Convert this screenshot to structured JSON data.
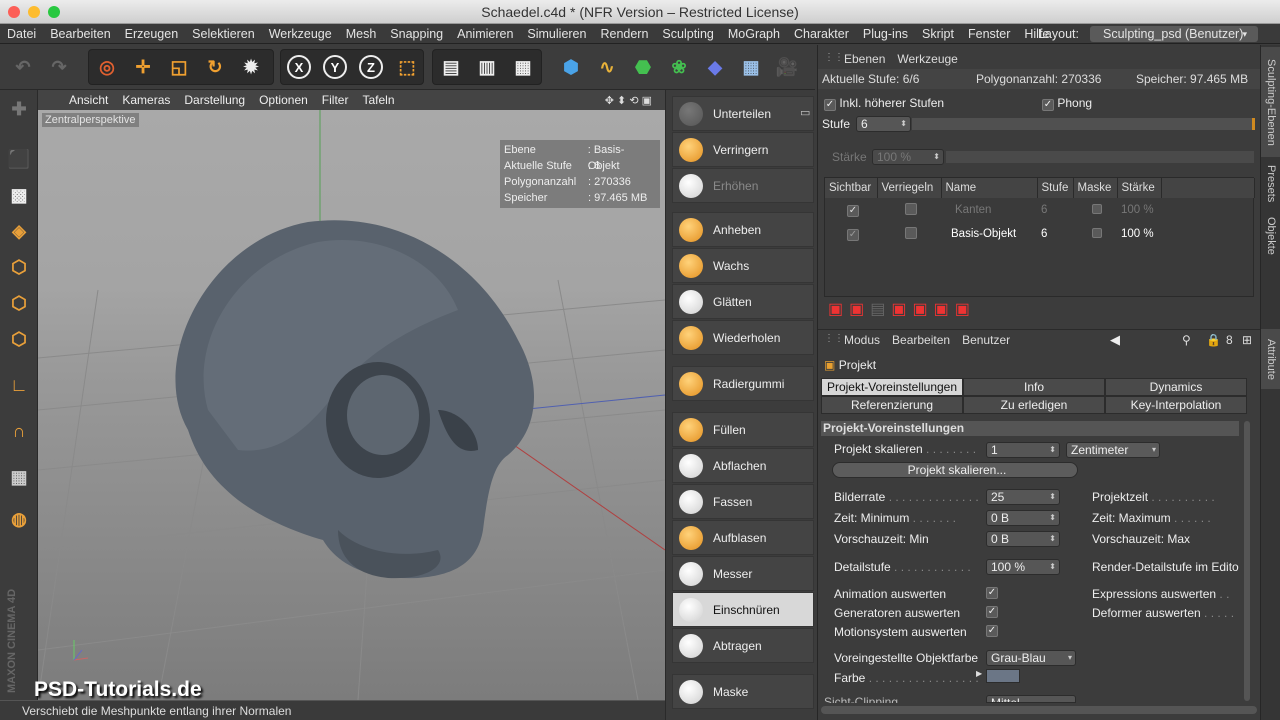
{
  "window": {
    "title": "Schaedel.c4d * (NFR Version – Restricted License)"
  },
  "menu": {
    "items": [
      "Datei",
      "Bearbeiten",
      "Erzeugen",
      "Selektieren",
      "Werkzeuge",
      "Mesh",
      "Snapping",
      "Animieren",
      "Simulieren",
      "Rendern",
      "Sculpting",
      "MoGraph",
      "Charakter",
      "Plug-ins",
      "Skript",
      "Fenster",
      "Hilfe"
    ],
    "layout_label": "Layout:",
    "layout_value": "Sculpting_psd (Benutzer)"
  },
  "toolbar": {
    "axis_x": "X",
    "axis_y": "Y",
    "axis_z": "Z"
  },
  "viewport": {
    "menu": [
      "Ansicht",
      "Kameras",
      "Darstellung",
      "Optionen",
      "Filter",
      "Tafeln"
    ],
    "label": "Zentralperspektive",
    "hud": [
      {
        "key": "Ebene",
        "value": ": Basis-Objekt"
      },
      {
        "key": "Aktuelle Stufe",
        "value": ": 6"
      },
      {
        "key": "Polygonanzahl",
        "value": ": 270336"
      },
      {
        "key": "Speicher",
        "value": ": 97.465 MB"
      }
    ],
    "watermark": "PSD-Tutorials.de",
    "maxon": "MAXON CINEMA 4D"
  },
  "status": "Verschiebt die Meshpunkte entlang ihrer Normalen",
  "sculpt_tools": [
    {
      "label": "Unterteilen",
      "state": "normal"
    },
    {
      "label": "Verringern",
      "state": "normal"
    },
    {
      "label": "Erhöhen",
      "state": "disabled"
    },
    {
      "label": "Anheben",
      "state": "normal"
    },
    {
      "label": "Wachs",
      "state": "normal"
    },
    {
      "label": "Glätten",
      "state": "normal"
    },
    {
      "label": "Wiederholen",
      "state": "normal"
    },
    {
      "label": "Radiergummi",
      "state": "normal"
    },
    {
      "label": "Füllen",
      "state": "normal"
    },
    {
      "label": "Abflachen",
      "state": "normal"
    },
    {
      "label": "Fassen",
      "state": "normal"
    },
    {
      "label": "Aufblasen",
      "state": "normal"
    },
    {
      "label": "Messer",
      "state": "normal"
    },
    {
      "label": "Einschnüren",
      "state": "selected"
    },
    {
      "label": "Abtragen",
      "state": "normal"
    },
    {
      "label": "Maske",
      "state": "normal"
    }
  ],
  "layers_panel": {
    "menu": [
      "Ebenen",
      "Werkzeuge"
    ],
    "aktuelle_stufe": "Aktuelle Stufe: 6/6",
    "polygonanzahl": "Polygonanzahl: 270336",
    "speicher": "Speicher: 97.465 MB",
    "inkl_label": "Inkl. höherer Stufen",
    "phong_label": "Phong",
    "stufe_label": "Stufe",
    "stufe_value": "6",
    "staerke_label": "Stärke",
    "staerke_value": "100 %",
    "columns": [
      "Sichtbar",
      "Verriegeln",
      "Name",
      "Stufe",
      "Maske",
      "Stärke"
    ],
    "rows": [
      {
        "name": "Kanten",
        "stufe": "6",
        "staerke": "100 %",
        "dim": true
      },
      {
        "name": "Basis-Objekt",
        "stufe": "6",
        "staerke": "100 %",
        "dim": false
      }
    ]
  },
  "right_tabs": {
    "sculpting": "Sculpting-Ebenen",
    "presets": "Presets",
    "objekte": "Objekte",
    "attribute": "Attribute"
  },
  "attributes": {
    "menu": [
      "Modus",
      "Bearbeiten",
      "Benutzer"
    ],
    "object": "Projekt",
    "tabs_row1": [
      "Projekt-Voreinstellungen",
      "Info",
      "Dynamics"
    ],
    "tabs_row2": [
      "Referenzierung",
      "Zu erledigen",
      "Key-Interpolation"
    ],
    "section": "Projekt-Voreinstellungen",
    "projekt_skalieren_label": "Projekt skalieren",
    "projekt_skalieren_value": "1",
    "einheit": "Zentimeter",
    "skalieren_button": "Projekt skalieren...",
    "bilderrate_label": "Bilderrate",
    "bilderrate_value": "25",
    "projektzeit_label": "Projektzeit",
    "zeit_min_label": "Zeit: Minimum",
    "zeit_min_value": "0 B",
    "zeit_max_label": "Zeit: Maximum",
    "vorschau_min_label": "Vorschauzeit: Min",
    "vorschau_min_value": "0 B",
    "vorschau_max_label": "Vorschauzeit: Max",
    "detailstufe_label": "Detailstufe",
    "detailstufe_value": "100 %",
    "render_detail_label": "Render-Detailstufe im Edito",
    "animation_label": "Animation auswerten",
    "expressions_label": "Expressions auswerten",
    "generatoren_label": "Generatoren auswerten",
    "deformer_label": "Deformer auswerten",
    "motionsystem_label": "Motionsystem auswerten",
    "objektfarbe_label": "Voreingestellte Objektfarbe",
    "objektfarbe_value": "Grau-Blau",
    "farbe_label": "Farbe",
    "sicht_label": "Sicht-Clipping",
    "sicht_value": "Mittel"
  }
}
